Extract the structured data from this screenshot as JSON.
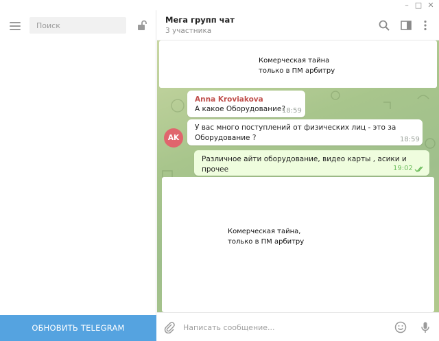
{
  "window": {
    "minimize_glyph": "–",
    "maximize_glyph": "□",
    "close_glyph": "✕"
  },
  "sidebar": {
    "search_placeholder": "Поиск",
    "update_button": "ОБНОВИТЬ TELEGRAM",
    "icons": {
      "menu": "hamburger-icon",
      "lock": "lock-icon"
    }
  },
  "header": {
    "title": "Мега групп чат",
    "subtitle": "3 участника",
    "icons": [
      "search-icon",
      "sidebar-toggle-icon",
      "more-vert-icon"
    ]
  },
  "messages": {
    "top_card": {
      "line1": "Комерческая тайна",
      "line2": "только в ПМ арбитру"
    },
    "msg1": {
      "sender": "Anna Kroviakova",
      "text": "А какое Оборудование?",
      "time": "18:59"
    },
    "msg2": {
      "line1": "У вас много поступлений от физических лиц - это за",
      "line2": "Оборудование ?",
      "time": "18:59"
    },
    "avatar_initials": "AK",
    "msg3": {
      "text": "Различное айти оборудование, видео карты , асики и прочее",
      "time": "19:02",
      "status": "read"
    },
    "bottom_card": {
      "line1": "Комерческая тайна,",
      "line2": "только в ПМ арбитру"
    }
  },
  "composer": {
    "placeholder": "Написать сообщение...",
    "icons": [
      "attach-icon",
      "emoji-icon",
      "microphone-icon"
    ]
  },
  "colors": {
    "accent": "#55a3e0",
    "sender_name": "#c0504d",
    "avatar": "#e0656d",
    "outgoing_bubble": "#effdde",
    "read_ticks": "#6ebd5e"
  }
}
